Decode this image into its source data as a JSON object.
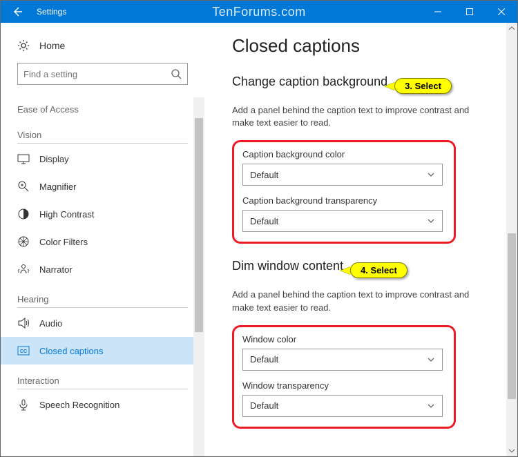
{
  "titlebar": {
    "title": "Settings",
    "watermark": "TenForums.com"
  },
  "sidebar": {
    "home": "Home",
    "search_placeholder": "Find a setting",
    "groups": [
      {
        "header": "Ease of Access"
      },
      {
        "header": "Vision"
      }
    ],
    "vision_items": [
      {
        "label": "Display",
        "icon": "display"
      },
      {
        "label": "Magnifier",
        "icon": "magnifier"
      },
      {
        "label": "High Contrast",
        "icon": "contrast"
      },
      {
        "label": "Color Filters",
        "icon": "color-filters"
      },
      {
        "label": "Narrator",
        "icon": "narrator"
      }
    ],
    "hearing_header": "Hearing",
    "hearing_items": [
      {
        "label": "Audio",
        "icon": "audio"
      },
      {
        "label": "Closed captions",
        "icon": "cc",
        "active": true
      }
    ],
    "interaction_header": "Interaction",
    "interaction_items": [
      {
        "label": "Speech Recognition",
        "icon": "mic"
      }
    ]
  },
  "main": {
    "page_title": "Closed captions",
    "section1": {
      "title": "Change caption background",
      "callout": "3. Select",
      "desc": "Add a panel behind the caption text to improve contrast and make text easier to read.",
      "field1_label": "Caption background color",
      "field1_value": "Default",
      "field2_label": "Caption background transparency",
      "field2_value": "Default"
    },
    "section2": {
      "title": "Dim window content",
      "callout": "4. Select",
      "desc": "Add a panel behind the caption text to improve contrast and make text easier to read.",
      "field1_label": "Window color",
      "field1_value": "Default",
      "field2_label": "Window transparency",
      "field2_value": "Default"
    }
  }
}
